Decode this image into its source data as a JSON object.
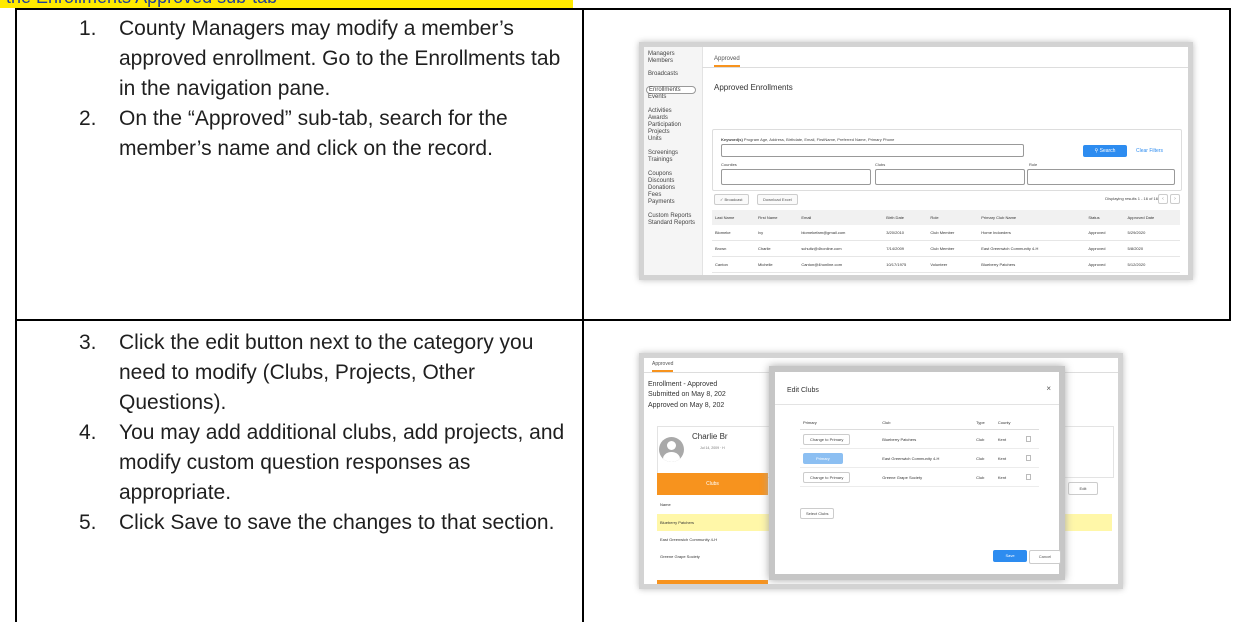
{
  "doc": {
    "header_fragment": "the Enrollments Approved sub-tab",
    "rows": [
      {
        "steps": [
          {
            "num": "1.",
            "text": "County Managers may modify a member’s approved enrollment. Go to the Enrollments tab in the navigation pane."
          },
          {
            "num": "2.",
            "text": "On the “Approved” sub-tab, search for the member’s name and click on the record."
          }
        ]
      },
      {
        "steps": [
          {
            "num": "3.",
            "text": "Click the edit button next to the category you need to modify (Clubs, Projects, Other Questions)."
          },
          {
            "num": "4.",
            "text": "You may add additional clubs, add projects, and modify custom question responses as appropriate."
          },
          {
            "num": "5.",
            "text": "Click Save to save the changes to that section."
          }
        ]
      }
    ]
  },
  "shot1": {
    "nav": [
      "Managers",
      "Members",
      "Broadcasts",
      "Enrollments",
      "Events",
      "Activities",
      "Awards",
      "Participation",
      "Projects",
      "Units",
      "Screenings",
      "Trainings",
      "Coupons",
      "Discounts",
      "Donations",
      "Fees",
      "Payments",
      "Custom Reports",
      "Standard Reports"
    ],
    "tab": "Approved",
    "heading": "Approved Enrollments",
    "keyword_label": "Keyword(s)",
    "keyword_hint": "Program Age, Address, Birthdate, Email, FirstName, Preferred Name, Primary Phone",
    "search_btn": "Search",
    "clear_btn": "Clear Filters",
    "counties_label": "Counties",
    "clubs_label": "Clubs",
    "role_label": "Role",
    "broadcast_btn": "Broadcast",
    "excel_btn": "Download Excel",
    "display_text": "Displaying results 1 - 16 of 16",
    "columns": [
      "Last Name",
      "First Name",
      "Email",
      "Birth Date",
      "Role",
      "Primary Club Name",
      "Status",
      "Approved Date"
    ],
    "rows": [
      [
        "Blomeke",
        "Ivy",
        "blomekefam@gmail.com",
        "3/20/2010",
        "Club Member",
        "Home Indoeders",
        "Approved",
        "5/29/2020"
      ],
      [
        "Brown",
        "Charlie",
        "schultz@4honline.com",
        "7/14/2009",
        "Club Member",
        "East Greenwich Community 4-H",
        "Approved",
        "5/8/2020"
      ],
      [
        "Canton",
        "Michelle",
        "Canton@4honline.com",
        "10/17/1975",
        "Volunteer",
        "Blueberry Patchers",
        "Approved",
        "5/12/2020"
      ]
    ]
  },
  "shot2": {
    "tab": "Approved",
    "title_line1": "Enrollment - Approved",
    "title_line2": "Submitted on May 8, 202",
    "title_line3": "Approved on May 8, 202",
    "member_name": "Charlie Br",
    "member_sub": "Jul 14, 2009 · H",
    "clubs_tab": "Clubs",
    "edit_btn": "Edit",
    "name_header": "Name",
    "clubs_list": [
      "Blueberry Patchers",
      "East Greenwich Community 4-H",
      "Greene Grape Society"
    ],
    "modal": {
      "title": "Edit Clubs",
      "close": "×",
      "columns": [
        "Primary",
        "Club",
        "Type",
        "County"
      ],
      "rows": [
        {
          "primary": "Change to Primary",
          "club": "Blueberry Patchers",
          "type": "Club",
          "county": "Kent",
          "is_primary": false
        },
        {
          "primary": "Primary",
          "club": "East Greenwich Community 4-H",
          "type": "Club",
          "county": "Kent",
          "is_primary": true
        },
        {
          "primary": "Change to Primary",
          "club": "Greene Grape Society",
          "type": "Club",
          "county": "Kent",
          "is_primary": false
        }
      ],
      "select_btn": "Select Clubs",
      "save_btn": "Save",
      "cancel_btn": "Cancel"
    },
    "colors": {
      "accent": "#f7931e",
      "highlight": "#fff7a8",
      "primary_blue": "#2d8cf0"
    }
  }
}
